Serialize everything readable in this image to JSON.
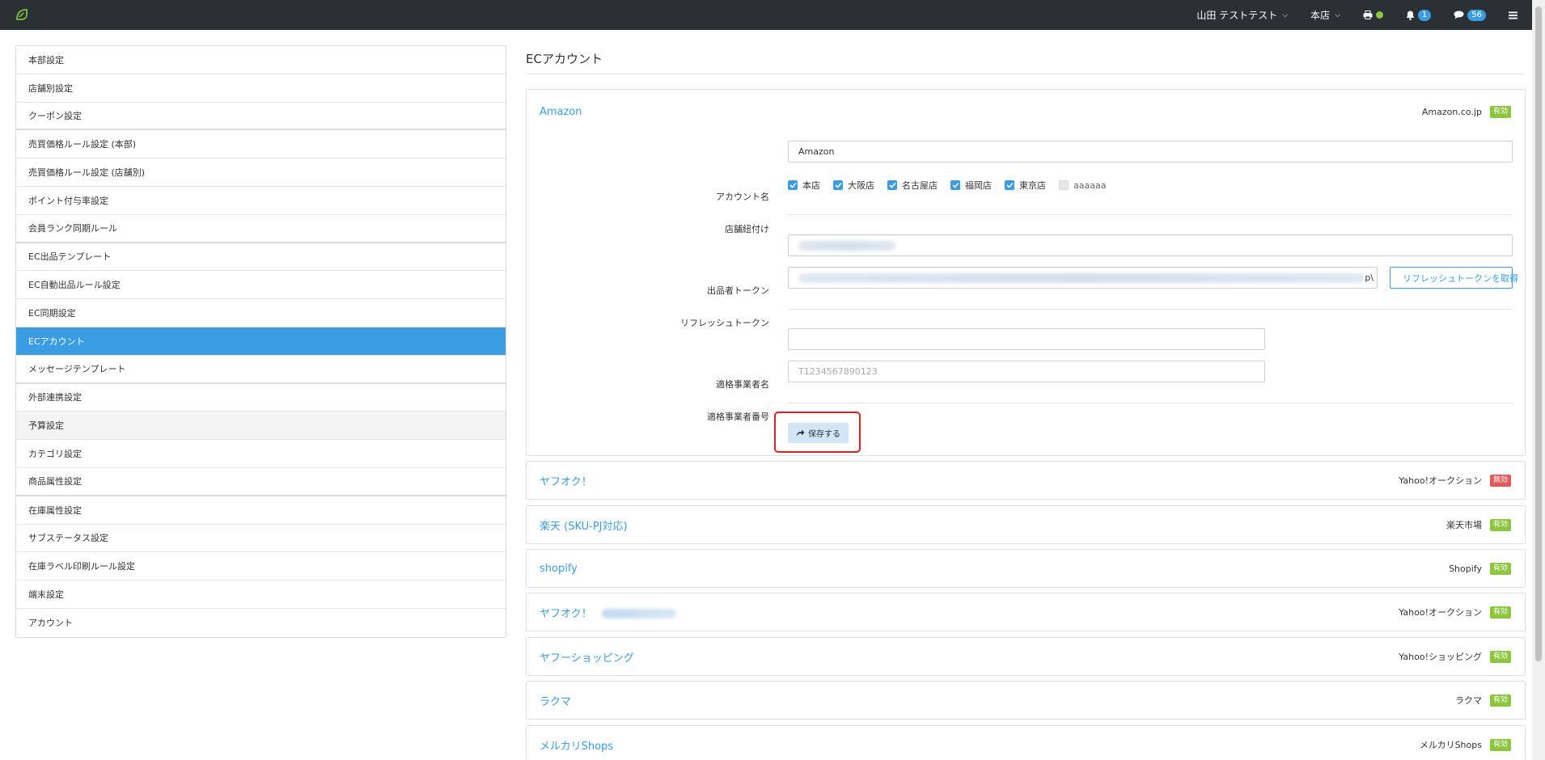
{
  "topbar": {
    "user": "山田 テストテスト",
    "store": "本店",
    "notifications_count": "1",
    "messages_count": "56",
    "icons": [
      "logo-icon",
      "printer-icon",
      "bell-icon",
      "chat-icon",
      "menu-icon"
    ],
    "colors": {
      "bar": "#2b3035",
      "accent": "#3a9de3",
      "online": "#8cc63f"
    }
  },
  "sidebar": {
    "items": [
      {
        "label": "本部設定"
      },
      {
        "label": "店舗別設定"
      },
      {
        "label": "クーポン設定"
      },
      {
        "label": "売買価格ルール設定 (本部)"
      },
      {
        "label": "売買価格ルール設定 (店舗別)"
      },
      {
        "label": "ポイント付与率設定"
      },
      {
        "label": "会員ランク同期ルール"
      },
      {
        "label": "EC出品テンプレート"
      },
      {
        "label": "EC自動出品ルール設定"
      },
      {
        "label": "EC同期設定"
      },
      {
        "label": "ECアカウント"
      },
      {
        "label": "メッセージテンプレート"
      },
      {
        "label": "外部連携設定"
      },
      {
        "label": "予算設定"
      },
      {
        "label": "カテゴリ設定"
      },
      {
        "label": "商品属性設定"
      },
      {
        "label": "在庫属性設定"
      },
      {
        "label": "サブステータス設定"
      },
      {
        "label": "在庫ラベル印刷ルール設定"
      },
      {
        "label": "端末設定"
      },
      {
        "label": "アカウント"
      }
    ],
    "active_item": "ECアカウント"
  },
  "main": {
    "title": "ECアカウント",
    "amazon": {
      "name": "Amazon",
      "marketplace": "Amazon.co.jp",
      "status": "有効",
      "account_name_label": "アカウント名",
      "account_name_value": "Amazon",
      "stores_label": "店舗紐付け",
      "stores": [
        {
          "label": "本店",
          "checked": true
        },
        {
          "label": "大阪店",
          "checked": true
        },
        {
          "label": "名古屋店",
          "checked": true
        },
        {
          "label": "福岡店",
          "checked": true
        },
        {
          "label": "東京店",
          "checked": true
        },
        {
          "label": "aaaaaa",
          "checked": false
        }
      ],
      "seller_token_label": "出品者トークン",
      "refresh_token_label": "リフレッシュトークン",
      "refresh_token_tail": "p\\",
      "get_refresh_token_button": "リフレッシュトークンを取得",
      "business_name_label": "適格事業者名",
      "business_name_value": "",
      "business_number_label": "適格事業者番号",
      "business_number_placeholder": "T1234567890123",
      "save_button": "保存する"
    },
    "accounts": [
      {
        "name": "ヤフオク！",
        "service": "Yahoo!オークション",
        "status": "無効",
        "status_type": "off"
      },
      {
        "name": "楽天 (SKU-PJ対応)",
        "service": "楽天市場",
        "status": "有効",
        "status_type": "on"
      },
      {
        "name": "shopify",
        "service": "Shopify",
        "status": "有効",
        "status_type": "on"
      },
      {
        "name": "ヤフオク！",
        "service": "Yahoo!オークション",
        "status": "有効",
        "status_type": "on"
      },
      {
        "name": "ヤフーショッピング",
        "service": "Yahoo!ショッピング",
        "status": "有効",
        "status_type": "on"
      },
      {
        "name": "ラクマ",
        "service": "ラクマ",
        "status": "有効",
        "status_type": "on"
      },
      {
        "name": "メルカリShops",
        "service": "メルカリShops",
        "status": "有効",
        "status_type": "on"
      }
    ]
  }
}
